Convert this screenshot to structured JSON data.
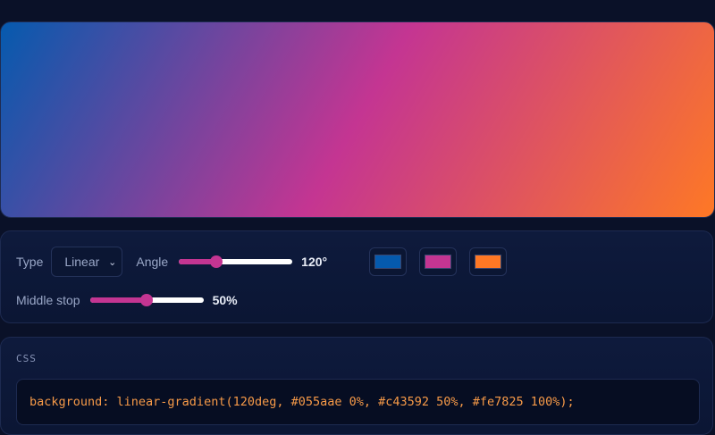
{
  "gradient": {
    "type": "linear",
    "angle_deg": 120,
    "stops": [
      {
        "color": "#055aae",
        "position": 0
      },
      {
        "color": "#c43592",
        "position": 50
      },
      {
        "color": "#fe7825",
        "position": 100
      }
    ]
  },
  "controls": {
    "type_label": "Type",
    "type_value": "Linear",
    "angle_label": "Angle",
    "angle_value_text": "120°",
    "angle_slider_fraction": 0.333,
    "middle_stop_label": "Middle stop",
    "middle_stop_value_text": "50%",
    "middle_stop_fraction": 0.5,
    "swatch_colors": [
      "#055aae",
      "#c43592",
      "#fe7825"
    ]
  },
  "code": {
    "label": "CSS",
    "text": "background: linear-gradient(120deg, #055aae 0%, #c43592 50%, #fe7825 100%);"
  }
}
